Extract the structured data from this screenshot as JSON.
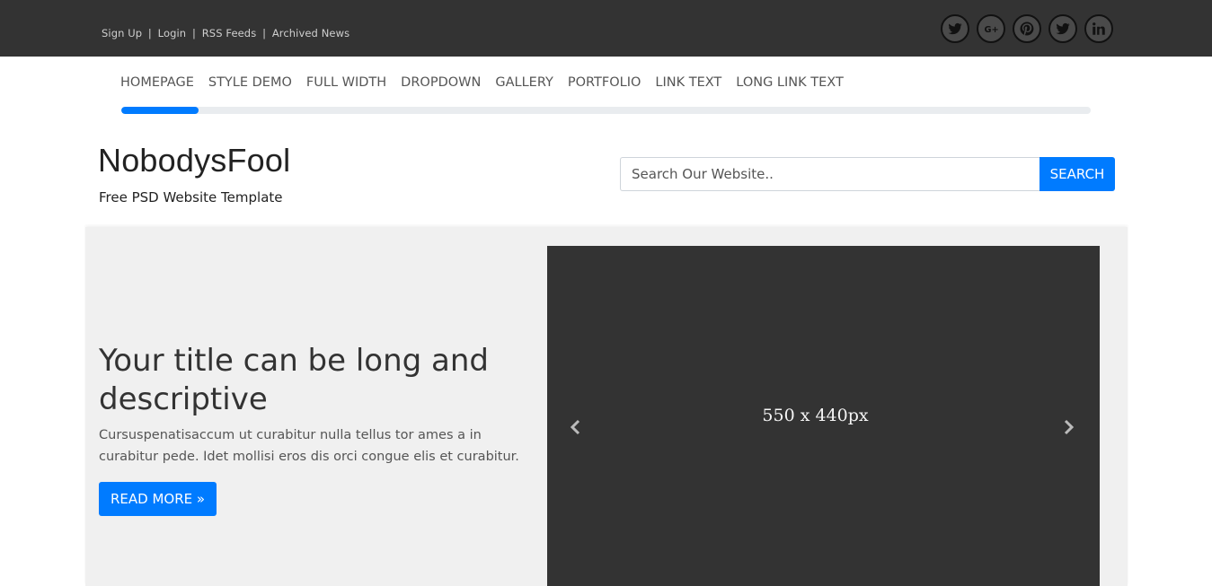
{
  "topbar": {
    "links": [
      "Sign Up",
      "Login",
      "RSS Feeds",
      "Archived News"
    ],
    "separator": "|",
    "social_icons": [
      "twitter-icon",
      "google-plus-icon",
      "pinterest-icon",
      "twitter-icon",
      "linkedin-icon"
    ]
  },
  "nav": {
    "items": [
      "HOMEPAGE",
      "STYLE DEMO",
      "FULL WIDTH",
      "DROPDOWN",
      "GALLERY",
      "PORTFOLIO",
      "LINK TEXT",
      "LONG LINK TEXT"
    ],
    "progress_fraction": 0.08
  },
  "header": {
    "brand": "NobodysFool",
    "tagline": "Free PSD Website Template"
  },
  "search": {
    "placeholder": "Search Our Website..",
    "button_label": "SEARCH"
  },
  "hero": {
    "title": "Your title can be long and descriptive",
    "text": "Cursuspenatisaccum ut curabitur nulla tellus tor ames a in curabitur pede. Idet mollisi eros dis orci congue elis et curabitur.",
    "button_label": "READ MORE »",
    "slider_label": "550 x 440px"
  },
  "colors": {
    "topbar_bg": "#333333",
    "accent": "#007bff",
    "hero_bg": "#f0f0f0",
    "slider_bg": "#333333"
  }
}
